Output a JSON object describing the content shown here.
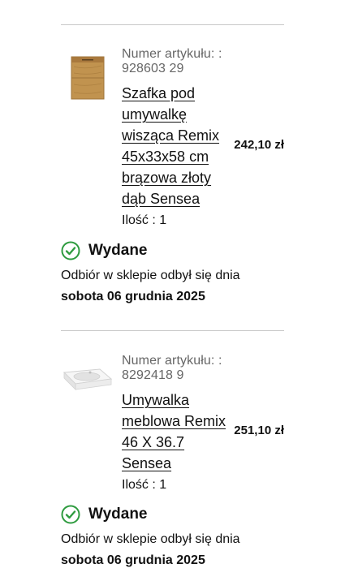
{
  "colors": {
    "status_green": "#2e9b3f",
    "divider": "#c9c9c9",
    "muted_text": "#666666"
  },
  "order_items": [
    {
      "article_label": "Numer artykułu: : 928603 29",
      "product_name": "Szafka pod umywalkę wisząca Remix 45x33x58 cm brązowa złoty dąb Sensea",
      "quantity": "Ilość : 1",
      "price": "242,10 zł",
      "image_icon": "wooden-vanity-cabinet-image",
      "status_icon": "check-circle-icon",
      "status": "Wydane",
      "pickup_text": "Odbiór w sklepie odbył się dnia",
      "pickup_date": "sobota 06 grudnia 2025"
    },
    {
      "article_label": "Numer artykułu: : 8292418 9",
      "product_name": "Umywalka meblowa Remix 46 X 36.7 Sensea",
      "quantity": "Ilość : 1",
      "price": "251,10 zł",
      "image_icon": "washbasin-image",
      "status_icon": "check-circle-icon",
      "status": "Wydane",
      "pickup_text": "Odbiór w sklepie odbył się dnia",
      "pickup_date": "sobota 06 grudnia 2025"
    }
  ]
}
